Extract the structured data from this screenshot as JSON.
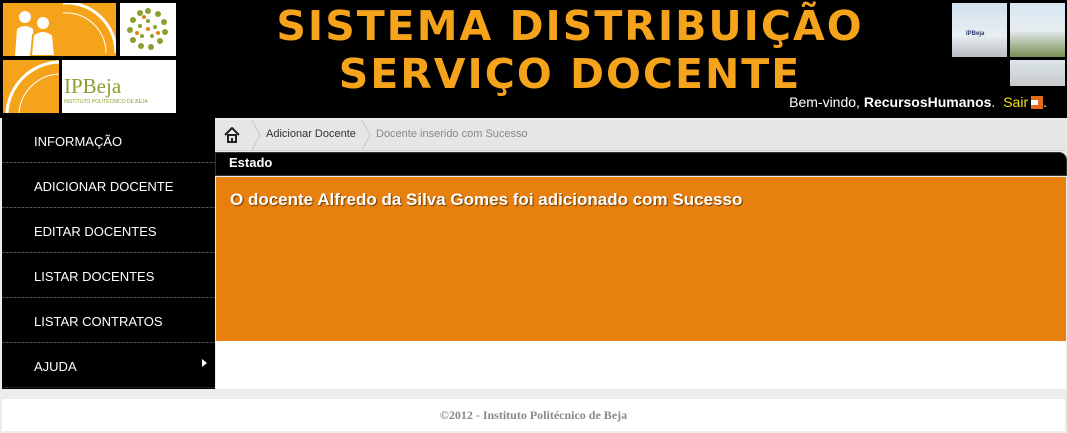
{
  "header": {
    "title_line1": "SISTEMA DISTRIBUIÇÃO",
    "title_line2": "SERVIÇO DOCENTE",
    "brand_logo_text": "IPBeja",
    "brand_logo_subtext": "INSTITUTO POLITÉCNICO DE BEJA",
    "photo_label": "IPBeja",
    "welcome_prefix": "Bem-vindo,",
    "username": "RecursosHumanos",
    "welcome_suffix": ".",
    "logout_label": "Sair"
  },
  "sidebar": {
    "items": [
      {
        "label": "INFORMAÇÃO"
      },
      {
        "label": "ADICIONAR DOCENTE"
      },
      {
        "label": "EDITAR DOCENTES"
      },
      {
        "label": "LISTAR DOCENTES"
      },
      {
        "label": "LISTAR CONTRATOS"
      },
      {
        "label": "AJUDA"
      }
    ]
  },
  "breadcrumb": {
    "items": [
      {
        "label": "Adicionar Docente"
      },
      {
        "label": "Docente inserido com Sucesso"
      }
    ]
  },
  "main": {
    "section_title": "Estado",
    "message": "O docente Alfredo da Silva Gomes foi adicionado com Sucesso"
  },
  "footer": {
    "text": "©2012 - Instituto Politécnico de Beja"
  },
  "colors": {
    "accent_orange": "#f5a31a",
    "panel_orange": "#e8800f",
    "header_black": "#000000"
  }
}
